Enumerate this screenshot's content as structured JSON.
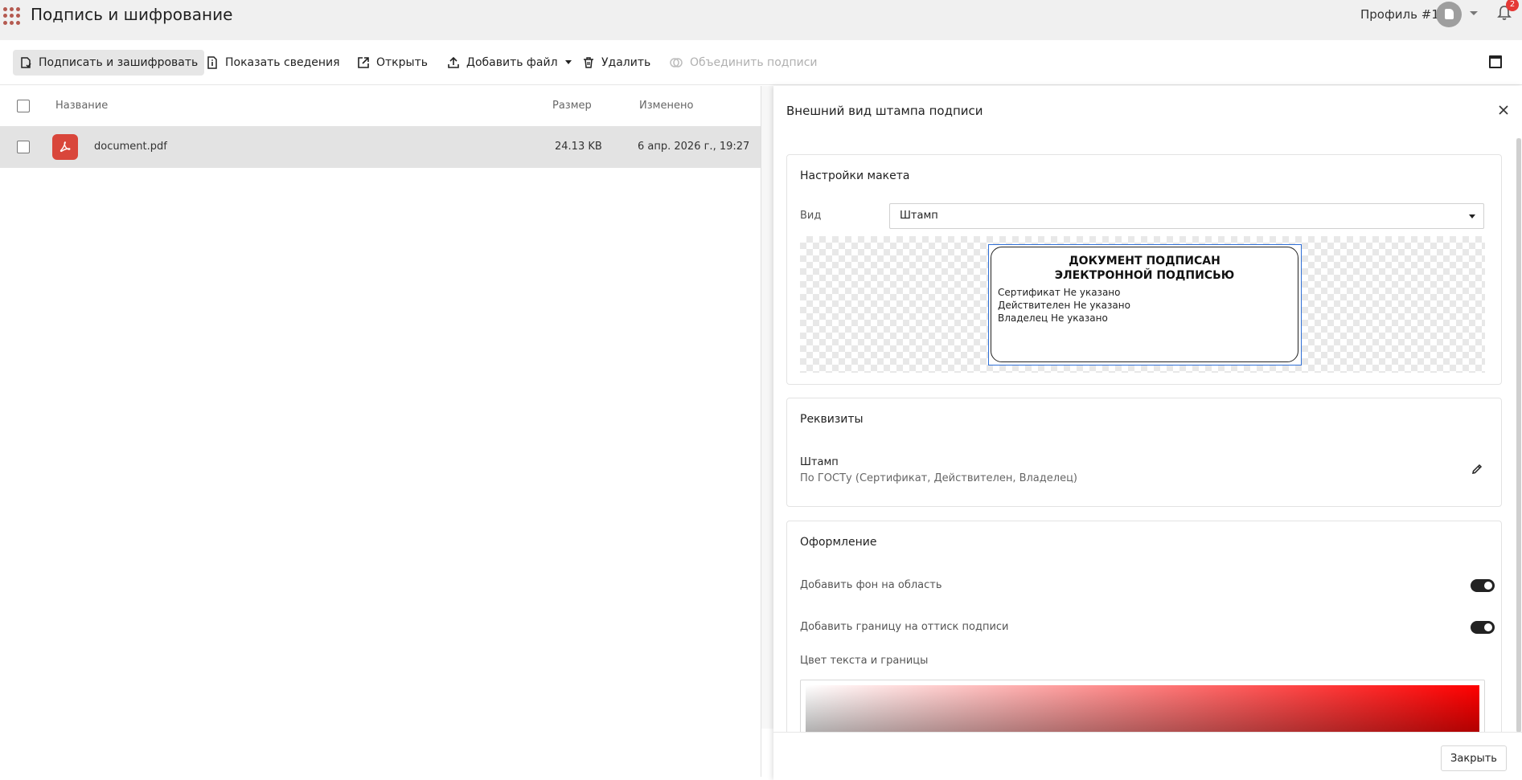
{
  "app": {
    "title": "Подпись и шифрование",
    "profile_name": "Профиль #1",
    "notification_count": "2"
  },
  "toolbar": {
    "sign_encrypt": "Подписать и зашифровать",
    "show_info": "Показать сведения",
    "open": "Открыть",
    "add_file": "Добавить файл",
    "delete": "Удалить",
    "merge_signatures": "Объединить подписи"
  },
  "file_list": {
    "columns": {
      "name": "Название",
      "size": "Размер",
      "modified": "Изменено"
    },
    "rows": [
      {
        "name": "document.pdf",
        "size": "24.13 KB",
        "modified": "6 апр. 2026 г., 19:27"
      }
    ]
  },
  "panel": {
    "title": "Внешний вид штампа подписи",
    "layout": {
      "title": "Настройки макета",
      "kind_label": "Вид",
      "kind_value": "Штамп",
      "stamp": {
        "heading_1": "ДОКУМЕНТ ПОДПИСАН",
        "heading_2": "ЭЛЕКТРОННОЙ ПОДПИСЬЮ",
        "line_1": "Сертификат Не указано",
        "line_2": "Действителен Не указано",
        "line_3": "Владелец Не указано"
      }
    },
    "requisites": {
      "title": "Реквизиты",
      "name": "Штамп",
      "description": "По ГОСТу (Сертификат, Действителен, Владелец)"
    },
    "design": {
      "title": "Оформление",
      "background_label": "Добавить фон на область",
      "background_on": true,
      "border_label": "Добавить границу на оттиск подписи",
      "border_on": true,
      "color_label": "Цвет текста и границы",
      "color_hue": "#ff0000"
    },
    "close_button": "Закрыть"
  }
}
